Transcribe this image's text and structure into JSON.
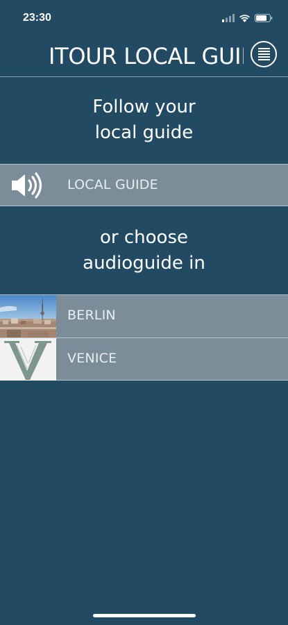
{
  "status_bar": {
    "time": "23:30",
    "icons": [
      "cellular-signal-icon",
      "wifi-icon",
      "battery-icon"
    ]
  },
  "header": {
    "title": "ITOUR LOCAL GUIDE",
    "menu_icon": "hamburger-menu-icon"
  },
  "intro": {
    "line1": "Follow your",
    "line2": "local guide"
  },
  "local_guide": {
    "label": "LOCAL GUIDE",
    "icon": "speaker-icon"
  },
  "choose": {
    "line1": "or choose",
    "line2": "audioguide in"
  },
  "cities": [
    {
      "label": "BERLIN",
      "thumbnail": "berlin-skyline-thumbnail"
    },
    {
      "label": "VENICE",
      "thumbnail": "venice-logo-thumbnail"
    }
  ],
  "colors": {
    "background": "#234a63",
    "row_background": "#7b8d99",
    "row_border": "#b7c4cc",
    "text": "#ffffff"
  }
}
